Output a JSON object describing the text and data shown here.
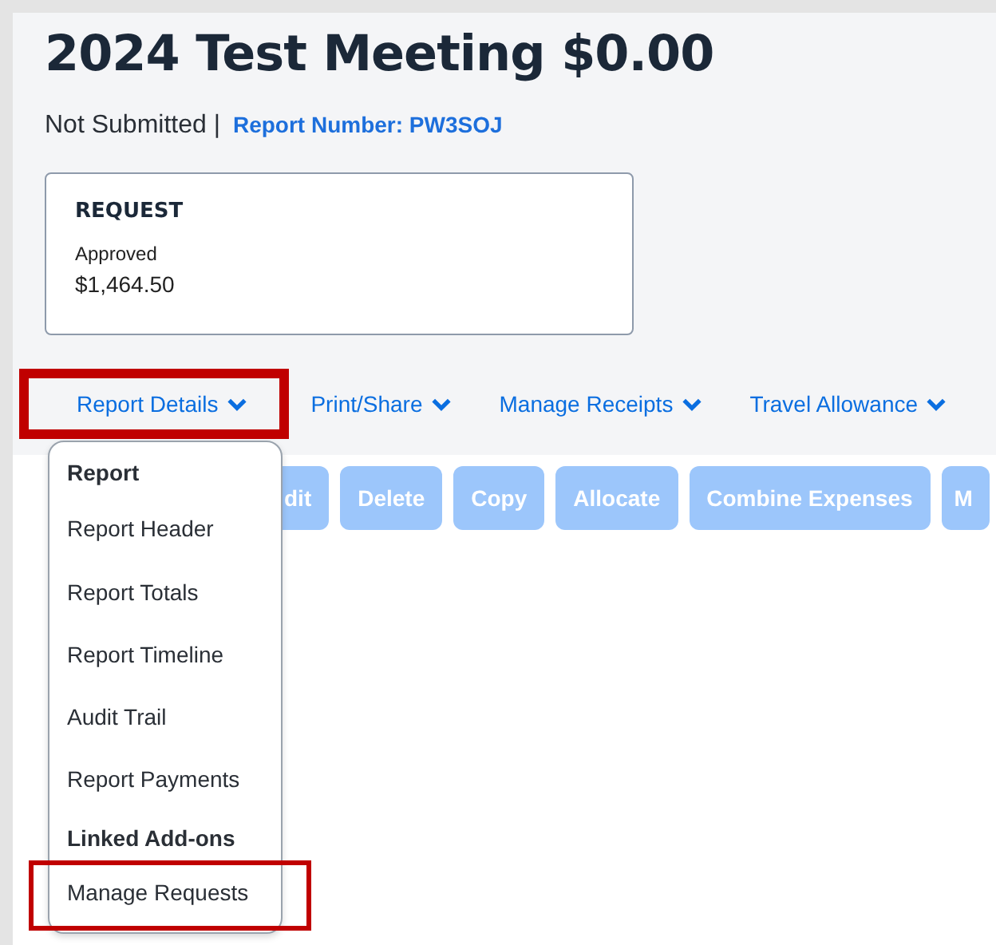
{
  "title": "2024 Test Meeting $0.00",
  "status": "Not Submitted |",
  "report_number": "Report Number: PW3SOJ",
  "request_card": {
    "heading": "REQUEST",
    "status": "Approved",
    "amount": "$1,464.50"
  },
  "menus": [
    {
      "label": "Report Details",
      "highlighted": true
    },
    {
      "label": "Print/Share",
      "highlighted": false
    },
    {
      "label": "Manage Receipts",
      "highlighted": false
    },
    {
      "label": "Travel Allowance",
      "highlighted": false
    }
  ],
  "actions": [
    {
      "label": "dit",
      "disabled": true
    },
    {
      "label": "Delete",
      "disabled": true
    },
    {
      "label": "Copy",
      "disabled": true
    },
    {
      "label": "Allocate",
      "disabled": true
    },
    {
      "label": "Combine Expenses",
      "disabled": true
    },
    {
      "label": "M",
      "disabled": true
    }
  ],
  "dropdown": [
    {
      "kind": "heading",
      "label": "Report",
      "highlighted": false
    },
    {
      "kind": "item",
      "label": "Report Header",
      "highlighted": false
    },
    {
      "kind": "item",
      "label": "Report Totals",
      "highlighted": false
    },
    {
      "kind": "item",
      "label": "Report Timeline",
      "highlighted": false
    },
    {
      "kind": "item",
      "label": "Audit Trail",
      "highlighted": false
    },
    {
      "kind": "item",
      "label": "Report Payments",
      "highlighted": false
    },
    {
      "kind": "heading",
      "label": "Linked Add-ons",
      "highlighted": false
    },
    {
      "kind": "item",
      "label": "Manage Requests",
      "highlighted": true
    }
  ]
}
